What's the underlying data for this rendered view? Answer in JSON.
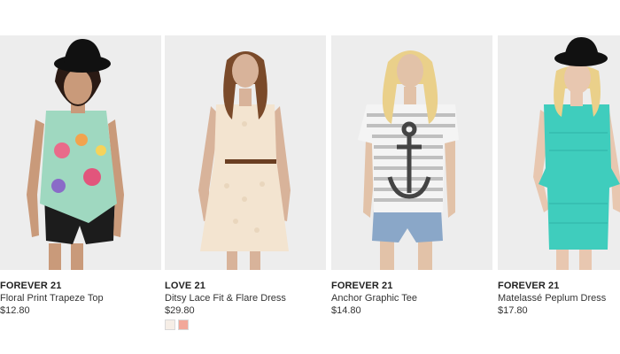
{
  "products": [
    {
      "brand": "FOREVER 21",
      "name": "Floral Print Trapeze Top",
      "price": "$12.80",
      "image_alt": "woman-in-floral-top-and-black-shorts"
    },
    {
      "brand": "LOVE 21",
      "name": "Ditsy Lace Fit & Flare Dress",
      "price": "$29.80",
      "image_alt": "woman-in-cream-lace-dress",
      "swatches": [
        {
          "color": "#f6eee6",
          "name": "cream"
        },
        {
          "color": "#f2a89a",
          "name": "coral"
        }
      ]
    },
    {
      "brand": "FOREVER 21",
      "name": "Anchor Graphic Tee",
      "price": "$14.80",
      "image_alt": "woman-in-striped-anchor-tee-and-denim-shorts"
    },
    {
      "brand": "FOREVER 21",
      "name": "Matelassé Peplum Dress",
      "price": "$17.80",
      "image_alt": "woman-in-teal-peplum-dress"
    }
  ]
}
